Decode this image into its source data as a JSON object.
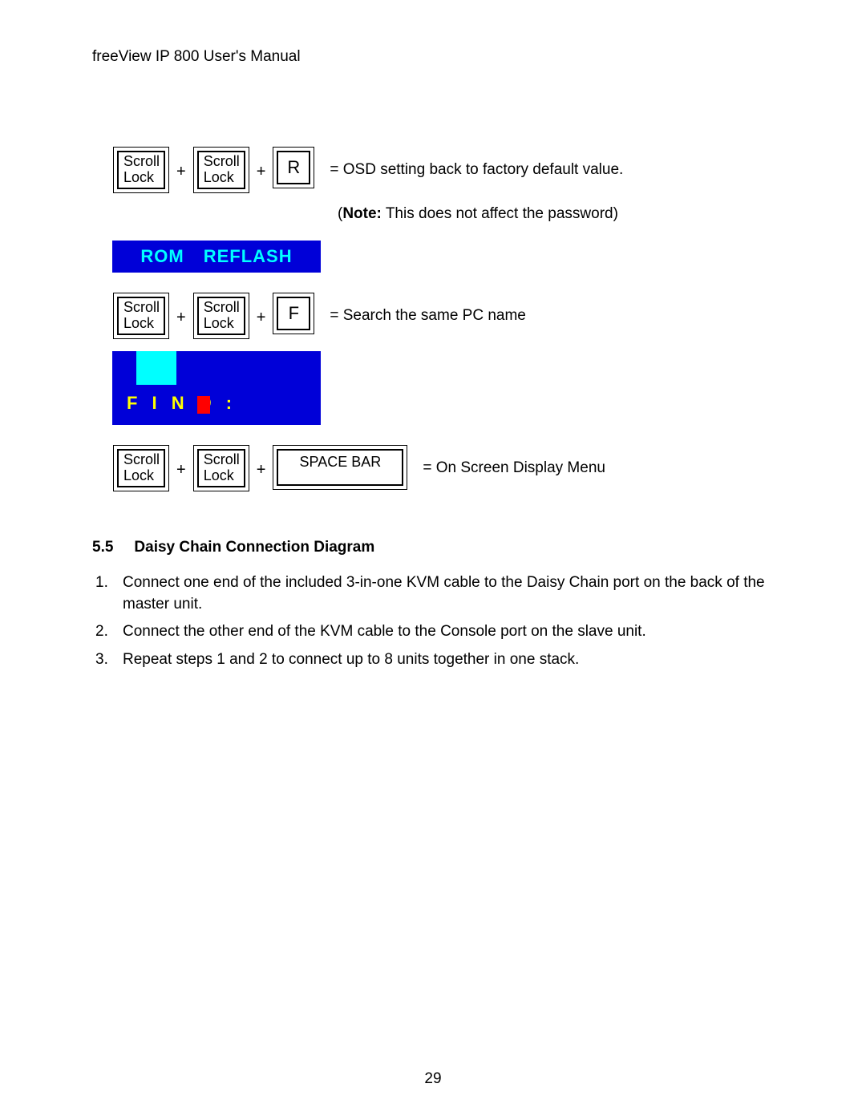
{
  "header": "freeView IP 800 User's Manual",
  "keys": {
    "scroll_lock_1": "Scroll",
    "scroll_lock_2": "Lock",
    "r": "R",
    "f": "F",
    "space": "SPACE BAR"
  },
  "plus": "+",
  "row1": {
    "desc": "= OSD setting back to factory default value."
  },
  "note_prefix": "(",
  "note_bold": "Note:",
  "note_rest": " This does not affect the password)",
  "rom": "ROM",
  "reflash": "REFLASH",
  "row2": {
    "desc": "= Search the same PC name"
  },
  "find_label": "F I N D :",
  "row3": {
    "desc": "= On Screen Display Menu"
  },
  "section": {
    "num": "5.5",
    "title": "Daisy Chain Connection Diagram"
  },
  "steps": [
    {
      "n": "1.",
      "t": "Connect one end of the included 3-in-one KVM cable to the Daisy Chain port on the back of the master unit."
    },
    {
      "n": "2.",
      "t": "Connect the other end of the KVM cable to the Console port on the slave unit."
    },
    {
      "n": "3.",
      "t": "Repeat steps 1 and 2 to connect up to 8 units together in one stack."
    }
  ],
  "page_number": "29"
}
